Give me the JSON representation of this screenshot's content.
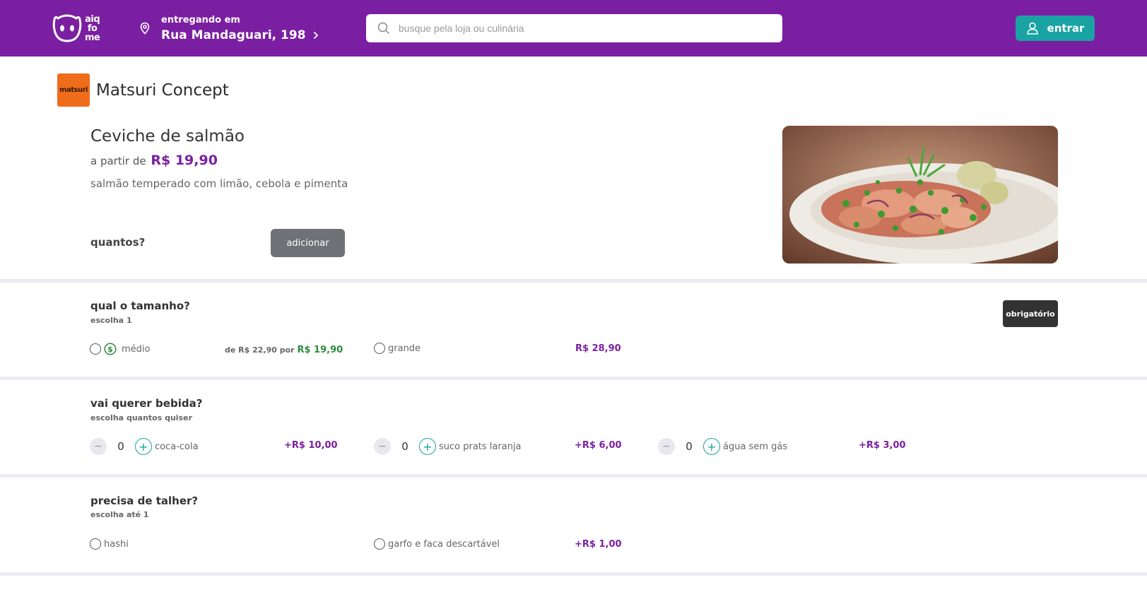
{
  "header": {
    "logo_lines": [
      "aiq",
      "fo",
      "me"
    ],
    "delivering_label": "entregando em",
    "address": "Rua Mandaguari, 198",
    "search_placeholder": "busque pela loja ou culinária",
    "login_label": "entrar",
    "brand_color": "#7b1fa2",
    "accent_color": "#1aa3a3"
  },
  "store": {
    "logo_text": "matsuri",
    "name": "Matsuri Concept"
  },
  "product": {
    "title": "Ceviche de salmão",
    "price_prefix": "a partir de",
    "price": "R$ 19,90",
    "description": "salmão temperado com limão, cebola e pimenta",
    "quantity_label": "quantos?",
    "add_label": "adicionar"
  },
  "sections": {
    "size": {
      "title": "qual o tamanho?",
      "subtitle": "escolha 1",
      "badge": "obrigatório",
      "options": [
        {
          "label": "médio",
          "price_old": "de R$ 22,90 por",
          "price": "R$ 19,90"
        },
        {
          "label": "grande",
          "price": "R$ 28,90"
        }
      ]
    },
    "drinks": {
      "title": "vai querer bebida?",
      "subtitle": "escolha quantos quiser",
      "options": [
        {
          "label": "coca-cola",
          "qty": "0",
          "price": "+R$ 10,00"
        },
        {
          "label": "suco prats laranja",
          "qty": "0",
          "price": "+R$ 6,00"
        },
        {
          "label": "água sem gás",
          "qty": "0",
          "price": "+R$ 3,00"
        }
      ]
    },
    "cutlery": {
      "title": "precisa de talher?",
      "subtitle": "escolha até 1",
      "options": [
        {
          "label": "hashi"
        },
        {
          "label": "garfo e faca descartável",
          "price": "+R$ 1,00"
        }
      ]
    }
  }
}
